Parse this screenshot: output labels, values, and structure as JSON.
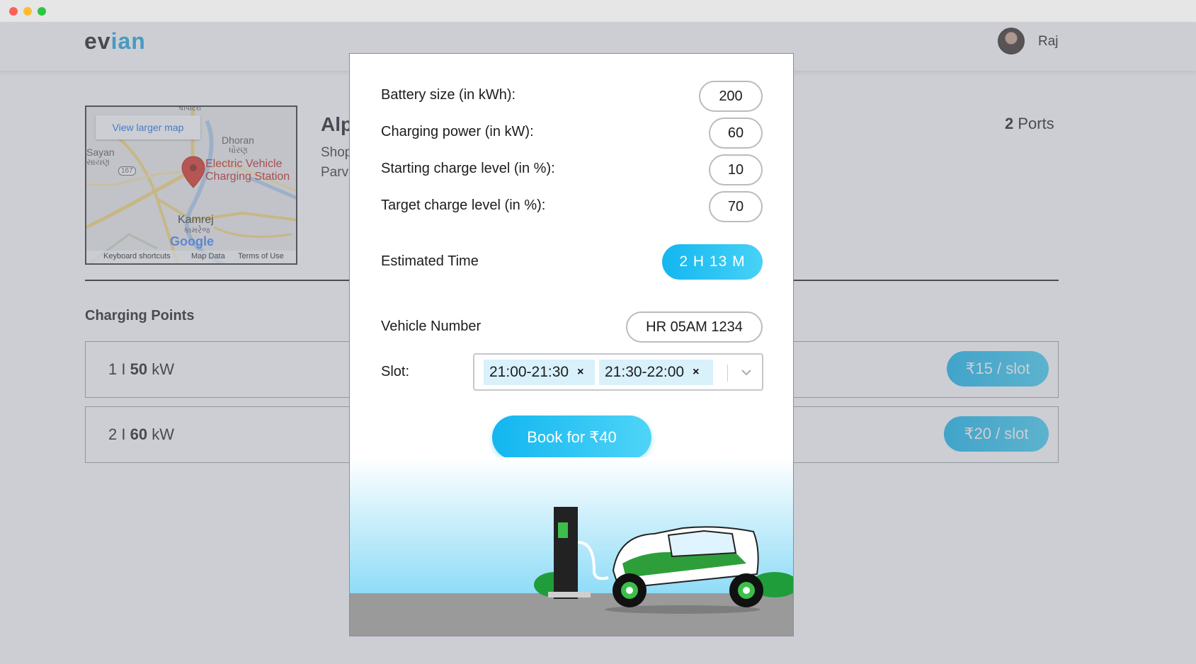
{
  "header": {
    "logo_part1": "ev",
    "logo_part2": "ian",
    "user_name": "Raj"
  },
  "map": {
    "view_larger": "View larger map",
    "labels": {
      "top": "चापाटरा",
      "dhoran": "Dhoran",
      "dhoran_gu": "ધોરણ",
      "sayan": "Sayan",
      "sayan_gu": "સાયણ",
      "route": "167",
      "station_line1": "Electric Vehicle",
      "station_line2": "Charging Station",
      "kamrej": "Kamrej",
      "kamrej_gu": "કામરેજ",
      "google": "Google"
    },
    "footer": {
      "shortcuts": "Keyboard shortcuts",
      "map_data": "Map Data",
      "terms": "Terms of Use"
    }
  },
  "station": {
    "name": "Alp",
    "address_line1": "Shop",
    "address_line2": "Parv",
    "ports_count": "2",
    "ports_label": "Ports"
  },
  "charging_points": {
    "title": "Charging Points",
    "items": [
      {
        "index": "1 I",
        "power": "50",
        "unit": "kW",
        "price": "₹15 / slot"
      },
      {
        "index": "2 I",
        "power": "60",
        "unit": "kW",
        "price": "₹20 / slot"
      }
    ]
  },
  "modal": {
    "battery_label": "Battery size (in kWh):",
    "battery_value": "200",
    "power_label": "Charging power (in kW):",
    "power_value": "60",
    "start_label": "Starting charge level (in %):",
    "start_value": "10",
    "target_label": "Target charge level (in %):",
    "target_value": "70",
    "est_label": "Estimated Time",
    "est_value": "2 H 13 M",
    "vehicle_label": "Vehicle Number",
    "vehicle_value": "HR 05AM 1234",
    "slot_label": "Slot:",
    "slots": [
      "21:00-21:30",
      "21:30-22:00"
    ],
    "slot_remove": "×",
    "book_label": "Book for ₹40"
  },
  "colors": {
    "accent": "#12b6f0",
    "logo_accent": "#1aa5e0",
    "chip_bg": "#d8f1fb",
    "overlay": "#858b96"
  }
}
